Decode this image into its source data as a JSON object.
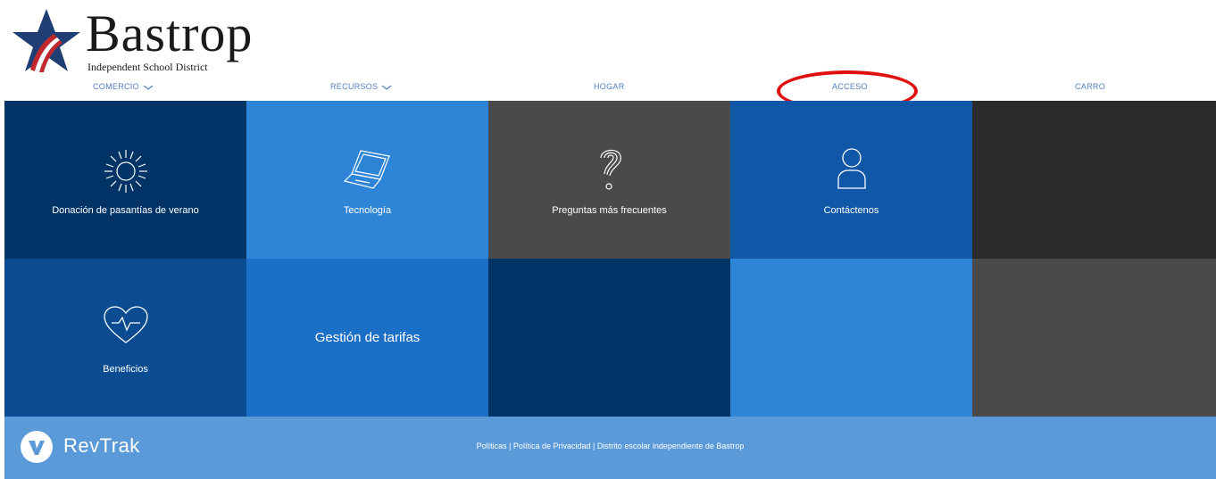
{
  "logo": {
    "name": "Bastrop",
    "subtitle": "Independent School District",
    "icon": "star-flag-icon"
  },
  "nav": {
    "items": [
      {
        "label": "COMERCIO",
        "has_dropdown": true
      },
      {
        "label": "RECURSOS",
        "has_dropdown": true
      },
      {
        "label": "HOGAR",
        "has_dropdown": false
      },
      {
        "label": "ACCESO",
        "has_dropdown": false,
        "highlighted": true
      },
      {
        "label": "CARRO",
        "has_dropdown": false
      }
    ]
  },
  "tiles": [
    {
      "label": "Donación de pasantías de verano",
      "icon": "sun-icon",
      "color": "#003366"
    },
    {
      "label": "Tecnología",
      "icon": "laptop-icon",
      "color": "#2e84d6"
    },
    {
      "label": "Preguntas más frecuentes",
      "icon": "question-icon",
      "color": "#4a4a4a"
    },
    {
      "label": "Contáctenos",
      "icon": "person-icon",
      "color": "#1057a8"
    },
    {
      "label": "",
      "icon": "",
      "color": "#2b2b2b"
    },
    {
      "label": "Beneficios",
      "icon": "heartbeat-icon",
      "color": "#0a4b91"
    },
    {
      "label": "Gestión de tarifas",
      "icon": "",
      "color": "#1c6fc6"
    },
    {
      "label": "",
      "icon": "",
      "color": "#003366"
    },
    {
      "label": "",
      "icon": "",
      "color": "#2e84d6"
    },
    {
      "label": "",
      "icon": "",
      "color": "#4a4a4a"
    }
  ],
  "footer": {
    "brand": "RevTrak",
    "brand_icon": "revtrak-v-icon",
    "links": "Políticas | Política de Privacidad | Distrito escolar independiente de Bastrop",
    "color": "#5b9ad8"
  },
  "annotation": {
    "color": "#e01010",
    "target": "ACCESO"
  }
}
